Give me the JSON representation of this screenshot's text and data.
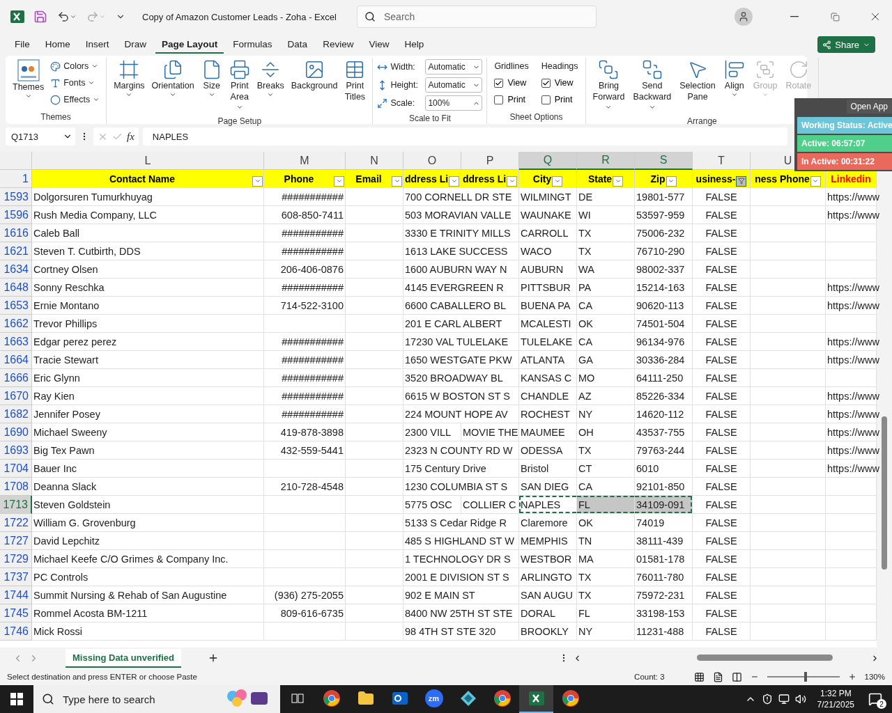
{
  "title_bar": {
    "title": "Copy of Amazon Customer Leads - Zoha  -  Excel",
    "search": {
      "placeholder": "Search"
    }
  },
  "menu_tabs": [
    {
      "label": "File",
      "selected": false
    },
    {
      "label": "Home",
      "selected": false
    },
    {
      "label": "Insert",
      "selected": false
    },
    {
      "label": "Draw",
      "selected": false
    },
    {
      "label": "Page Layout",
      "selected": true
    },
    {
      "label": "Formulas",
      "selected": false
    },
    {
      "label": "Data",
      "selected": false
    },
    {
      "label": "Review",
      "selected": false
    },
    {
      "label": "View",
      "selected": false
    },
    {
      "label": "Help",
      "selected": false
    }
  ],
  "share_button": "Share",
  "themes_group": {
    "title": "Themes",
    "themes_button": "Themes",
    "options": [
      "Colors",
      "Fonts",
      "Effects"
    ]
  },
  "page_setup_group": {
    "title": "Page Setup",
    "buttons": [
      {
        "lines": [
          "Margins"
        ],
        "menu": true
      },
      {
        "lines": [
          "Orientation"
        ],
        "menu": true
      },
      {
        "lines": [
          "Size"
        ],
        "menu": true
      },
      {
        "lines": [
          "Print",
          "Area"
        ],
        "menu": true
      },
      {
        "lines": [
          "Breaks"
        ],
        "menu": true
      },
      {
        "lines": [
          "Background"
        ],
        "menu": false
      },
      {
        "lines": [
          "Print",
          "Titles"
        ],
        "menu": false
      }
    ]
  },
  "scale_group": {
    "title": "Scale to Fit",
    "fields": [
      {
        "label": "Width:",
        "value": "Automatic"
      },
      {
        "label": "Height:",
        "value": "Automatic"
      },
      {
        "label": "Scale:",
        "value": "100%"
      }
    ]
  },
  "sheet_options_group": {
    "title": "Sheet Options",
    "sections": [
      {
        "heading": "Gridlines",
        "options": [
          {
            "label": "View",
            "checked": true
          },
          {
            "label": "Print",
            "checked": false
          }
        ]
      },
      {
        "heading": "Headings",
        "options": [
          {
            "label": "View",
            "checked": true
          },
          {
            "label": "Print",
            "checked": false
          }
        ]
      }
    ]
  },
  "arrange_group": {
    "title": "Arrange",
    "buttons": [
      {
        "lines": [
          "Bring",
          "Forward"
        ],
        "menu": true,
        "disabled": false
      },
      {
        "lines": [
          "Send",
          "Backward"
        ],
        "menu": true,
        "disabled": false
      },
      {
        "lines": [
          "Selection",
          "Pane"
        ],
        "menu": false,
        "disabled": false
      },
      {
        "lines": [
          "Align"
        ],
        "menu": true,
        "disabled": false
      },
      {
        "lines": [
          "Group"
        ],
        "menu": true,
        "disabled": true
      },
      {
        "lines": [
          "Rotate"
        ],
        "menu": false,
        "disabled": true
      }
    ]
  },
  "formula_bar": {
    "name_box": "Q1713",
    "function_label": "fx",
    "value": "NAPLES"
  },
  "columns": [
    {
      "letter": "L",
      "selected": false,
      "header": "Contact Name",
      "filter": true,
      "filtered": false,
      "color": "#000000"
    },
    {
      "letter": "M",
      "selected": false,
      "header": "Phone",
      "filter": true,
      "filtered": false,
      "color": "#000000"
    },
    {
      "letter": "N",
      "selected": false,
      "header": "Email",
      "filter": true,
      "filtered": false,
      "color": "#000000"
    },
    {
      "letter": "O",
      "selected": false,
      "header": "ddress Li",
      "filter": true,
      "filtered": false,
      "color": "#000000"
    },
    {
      "letter": "P",
      "selected": false,
      "header": "ddress Li",
      "filter": true,
      "filtered": false,
      "color": "#000000"
    },
    {
      "letter": "Q",
      "selected": true,
      "header": "City",
      "filter": true,
      "filtered": false,
      "color": "#000000"
    },
    {
      "letter": "R",
      "selected": true,
      "header": "State",
      "filter": true,
      "filtered": false,
      "color": "#000000"
    },
    {
      "letter": "S",
      "selected": true,
      "header": "Zip",
      "filter": true,
      "filtered": false,
      "color": "#000000"
    },
    {
      "letter": "T",
      "selected": false,
      "header": "usiness-",
      "filter": true,
      "filtered": true,
      "color": "#000000"
    },
    {
      "letter": "U",
      "selected": false,
      "header": "ness Phone",
      "filter": true,
      "filtered": false,
      "color": "#000000"
    },
    {
      "header": "Linkedin",
      "filter": false,
      "color": "#ff0000"
    }
  ],
  "header_row_number": "1",
  "rows": [
    {
      "number": "1593",
      "selected": false,
      "cells": {
        "contact_name": "Dolgorsuren Tumurkhuyag",
        "phone": "###########",
        "column_o": "700 CORNELL DR STE",
        "city": "WILMINGT",
        "state": "DE",
        "zip": "19801-577",
        "column_t": "FALSE",
        "linkedin": "https://www"
      }
    },
    {
      "number": "1596",
      "selected": false,
      "cells": {
        "contact_name": "Rush Media Company, LLC",
        "phone": "608-850-7411",
        "column_o": "503 MORAVIAN VALLE",
        "city": "WAUNAKE",
        "state": "WI",
        "zip": "53597-959",
        "column_t": "FALSE",
        "linkedin": "https://www"
      }
    },
    {
      "number": "1616",
      "selected": false,
      "cells": {
        "contact_name": "Caleb Ball",
        "phone": "###########",
        "column_o": "3330 E TRINITY MILLS",
        "city": "CARROLL",
        "state": "TX",
        "zip": "75006-232",
        "column_t": "FALSE"
      }
    },
    {
      "number": "1621",
      "selected": false,
      "cells": {
        "contact_name": "Steven T. Cutbirth, DDS",
        "phone": "###########",
        "column_o": "1613 LAKE SUCCESS",
        "city": "WACO",
        "state": "TX",
        "zip": "76710-290",
        "column_t": "FALSE"
      }
    },
    {
      "number": "1634",
      "selected": false,
      "cells": {
        "contact_name": "Cortney Olsen",
        "phone": "206-406-0876",
        "column_o": "1600 AUBURN WAY N",
        "city": "AUBURN",
        "state": "WA",
        "zip": "98002-337",
        "column_t": "FALSE"
      }
    },
    {
      "number": "1648",
      "selected": false,
      "cells": {
        "contact_name": "Sonny Reschka",
        "phone": "###########",
        "column_o": "4145 EVERGREEN R",
        "city": "PITTSBUR",
        "state": "PA",
        "zip": "15214-163",
        "column_t": "FALSE",
        "linkedin": "https://www"
      }
    },
    {
      "number": "1653",
      "selected": false,
      "cells": {
        "contact_name": "Ernie Montano",
        "phone": "714-522-3100",
        "column_o": "6600 CABALLERO BL",
        "city": "BUENA PA",
        "state": "CA",
        "zip": "90620-113",
        "column_t": "FALSE",
        "linkedin": "https://www"
      }
    },
    {
      "number": "1662",
      "selected": false,
      "cells": {
        "contact_name": "Trevor Phillips",
        "column_o": "201 E CARL ALBERT",
        "city": "MCALESTI",
        "state": "OK",
        "zip": "74501-504",
        "column_t": "FALSE"
      }
    },
    {
      "number": "1663",
      "selected": false,
      "cells": {
        "contact_name": "Edgar  perez perez",
        "phone": "###########",
        "column_o": "17230 VAL TULELAKE",
        "city": "TULELAKE",
        "state": "CA",
        "zip": "96134-976",
        "column_t": "FALSE",
        "linkedin": "https://www"
      }
    },
    {
      "number": "1664",
      "selected": false,
      "cells": {
        "contact_name": "Tracie Stewart",
        "phone": "###########",
        "column_o": "1650 WESTGATE PKW",
        "city": "ATLANTA",
        "state": "GA",
        "zip": "30336-284",
        "column_t": "FALSE",
        "linkedin": "https://www"
      }
    },
    {
      "number": "1666",
      "selected": false,
      "cells": {
        "contact_name": "Eric Glynn",
        "phone": "###########",
        "column_o": "3520 BROADWAY BL",
        "city": "KANSAS C",
        "state": "MO",
        "zip": "64111-250",
        "column_t": "FALSE"
      }
    },
    {
      "number": "1670",
      "selected": false,
      "cells": {
        "contact_name": "Ray Kien",
        "phone": "###########",
        "column_o": "6615 W BOSTON ST S",
        "city": "CHANDLE",
        "state": "AZ",
        "zip": "85226-334",
        "column_t": "FALSE",
        "linkedin": "https://www"
      }
    },
    {
      "number": "1682",
      "selected": false,
      "cells": {
        "contact_name": "Jennifer Posey",
        "phone": "###########",
        "column_o": "224 MOUNT HOPE AV",
        "city": "ROCHEST",
        "state": "NY",
        "zip": "14620-112",
        "column_t": "FALSE",
        "linkedin": "https://www"
      }
    },
    {
      "number": "1690",
      "selected": false,
      "cells": {
        "contact_name": "Michael Sweeny",
        "phone": "419-878-3898",
        "column_o": "2300 VILL",
        "column_p": "MOVIE THE",
        "city": "MAUMEE",
        "state": "OH",
        "zip": "43537-755",
        "column_t": "FALSE",
        "linkedin": "https://www"
      }
    },
    {
      "number": "1693",
      "selected": false,
      "cells": {
        "contact_name": "Big Tex Pawn",
        "phone": "432-559-5441",
        "column_o": "2323 N COUNTY RD W",
        "city": "ODESSA",
        "state": "TX",
        "zip": "79763-244",
        "column_t": "FALSE",
        "linkedin": "https://www"
      }
    },
    {
      "number": "1704",
      "selected": false,
      "cells": {
        "contact_name": "Bauer Inc",
        "column_o": "175 Century Drive",
        "city": "Bristol",
        "state": "CT",
        "zip": "6010",
        "column_t": "FALSE",
        "linkedin": "https://www"
      }
    },
    {
      "number": "1708",
      "selected": false,
      "cells": {
        "contact_name": "Deanna Slack",
        "phone": "210-728-4548",
        "column_o": "1230 COLUMBIA ST S",
        "city": "SAN DIEG",
        "state": "CA",
        "zip": "92101-850",
        "column_t": "FALSE"
      }
    },
    {
      "number": "1713",
      "selected": true,
      "cells": {
        "contact_name": "Steven Goldstein",
        "column_o": "5775 OSC",
        "column_p": "COLLIER C",
        "city": "NAPLES",
        "state": "FL",
        "zip": "34109-091",
        "column_t": "FALSE"
      }
    },
    {
      "number": "1722",
      "selected": false,
      "cells": {
        "contact_name": "William G. Grovenburg",
        "column_o": "5133 S Cedar Ridge R",
        "city": "Claremore",
        "state": "OK",
        "zip": "74019",
        "column_t": "FALSE"
      }
    },
    {
      "number": "1727",
      "selected": false,
      "cells": {
        "contact_name": "David Lepchitz",
        "column_o": "485 S HIGHLAND ST W",
        "city": "MEMPHIS",
        "state": "TN",
        "zip": "38111-439",
        "column_t": "FALSE"
      }
    },
    {
      "number": "1729",
      "selected": false,
      "cells": {
        "contact_name": "Michael Keefe C/O Grimes & Company Inc.",
        "column_o": "1 TECHNOLOGY DR S",
        "city": "WESTBOR",
        "state": "MA",
        "zip": "01581-178",
        "column_t": "FALSE"
      }
    },
    {
      "number": "1737",
      "selected": false,
      "cells": {
        "contact_name": "PC Controls",
        "column_o": "2001 E DIVISION ST S",
        "city": "ARLINGTO",
        "state": "TX",
        "zip": "76011-780",
        "column_t": "FALSE"
      }
    },
    {
      "number": "1744",
      "selected": false,
      "cells": {
        "contact_name": "Summit Nursing & Rehab of San Augustine",
        "phone": "(936) 275-2055",
        "column_o": "902 E MAIN ST",
        "city": "SAN AUGU",
        "state": "TX",
        "zip": "75972-231",
        "column_t": "FALSE"
      }
    },
    {
      "number": "1745",
      "selected": false,
      "cells": {
        "contact_name": "Rommel Acosta BM-1211",
        "phone": "809-616-6735",
        "column_o": "8400 NW 25TH ST STE",
        "city": "DORAL",
        "state": "FL",
        "zip": "33198-153",
        "column_t": "FALSE"
      }
    },
    {
      "number": "1746",
      "selected": false,
      "cells": {
        "contact_name": "Mick Rossi",
        "column_o": "98 4TH ST STE 320",
        "city": "BROOKLY",
        "state": "NY",
        "zip": "11231-488",
        "column_t": "FALSE"
      }
    }
  ],
  "sheet_tabs": [
    {
      "label": "Missing Data unverified",
      "selected": true
    }
  ],
  "status_bar": {
    "message": "Select destination and press ENTER or choose Paste",
    "count": "Count: 3",
    "zoom": {
      "label": "130%",
      "level": 0.53
    }
  },
  "tracker_overlay": {
    "button": "Open App",
    "bars": [
      {
        "label": "Working Status: Active",
        "color": "#6cc5d8"
      },
      {
        "label": "Active: 06:57:07",
        "color": "#4fcf8a"
      },
      {
        "label": "In Active: 00:31:22",
        "color": "#e96a5d"
      }
    ]
  },
  "taskbar": {
    "search": {
      "placeholder": "Type here to search"
    },
    "apps": [
      {
        "kind": "taskview",
        "selected": false
      },
      {
        "kind": "chrome",
        "selected": false
      },
      {
        "kind": "folder",
        "selected": false
      },
      {
        "kind": "mail",
        "selected": false
      },
      {
        "kind": "meeting",
        "label": "zm",
        "selected": false
      },
      {
        "kind": "diamond",
        "selected": false
      },
      {
        "kind": "chrome",
        "selected": false
      },
      {
        "kind": "sheet",
        "selected": true
      },
      {
        "kind": "chrome",
        "selected": false
      }
    ],
    "time": "1:32 PM",
    "date": "7/21/2025",
    "notifications": "2"
  }
}
